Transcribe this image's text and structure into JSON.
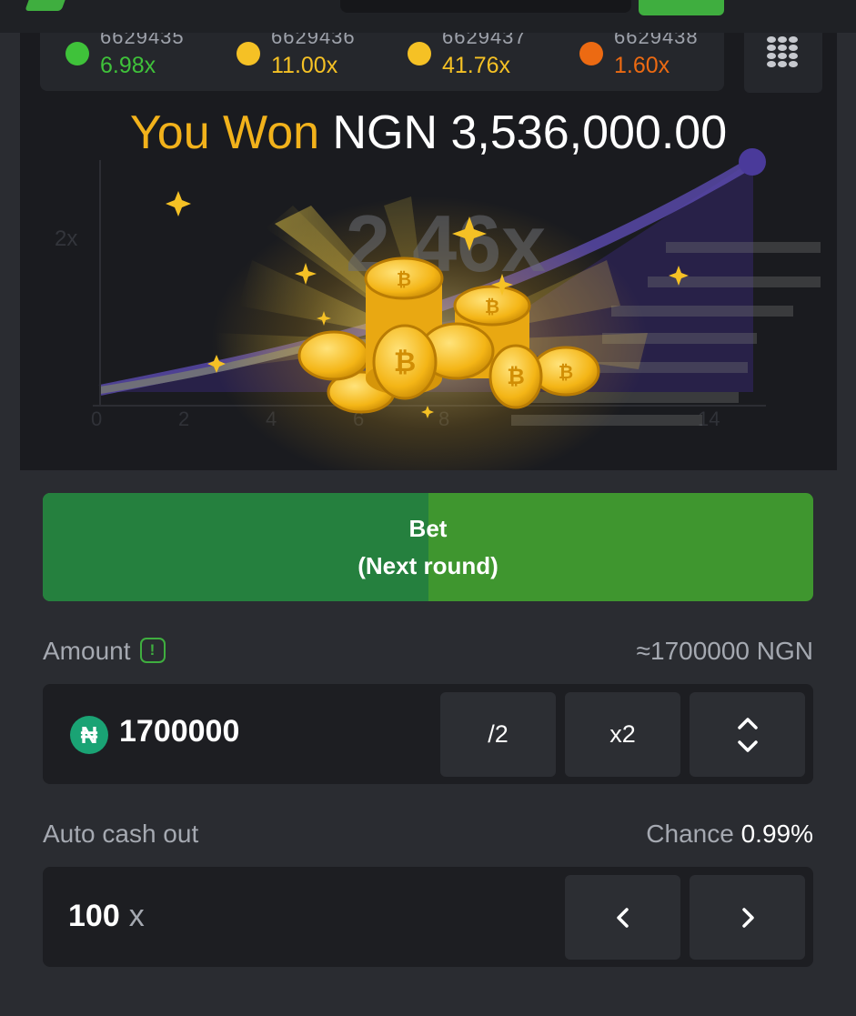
{
  "history": [
    {
      "round_id": "6629435",
      "multiplier": "6.98x",
      "color": "#3fc23a"
    },
    {
      "round_id": "6629436",
      "multiplier": "11.00x",
      "color": "#f5c125"
    },
    {
      "round_id": "6629437",
      "multiplier": "41.76x",
      "color": "#f5c125"
    },
    {
      "round_id": "6629438",
      "multiplier": "1.60x",
      "color": "#ec6a12"
    }
  ],
  "win": {
    "label": "You Won",
    "amount": "NGN 3,536,000.00"
  },
  "chart": {
    "current_multiplier": "2.46x",
    "y_tick": "2x",
    "x_ticks": [
      "0",
      "2",
      "4",
      "6",
      "8",
      "14"
    ]
  },
  "bet_button": {
    "line1": "Bet",
    "line2": "(Next round)",
    "progress": 0.5
  },
  "amount": {
    "label": "Amount",
    "equivalent": "≈1700000 NGN",
    "currency_symbol": "₦",
    "value": "1700000",
    "half_label": "/2",
    "double_label": "x2"
  },
  "auto_cashout": {
    "label": "Auto cash out",
    "chance_label": "Chance",
    "chance_value": "0.99%",
    "value": "100",
    "suffix": "x"
  },
  "colors": {
    "accent_green": "#3fae3f",
    "gold": "#f2b21b",
    "background": "#2a2c31"
  }
}
